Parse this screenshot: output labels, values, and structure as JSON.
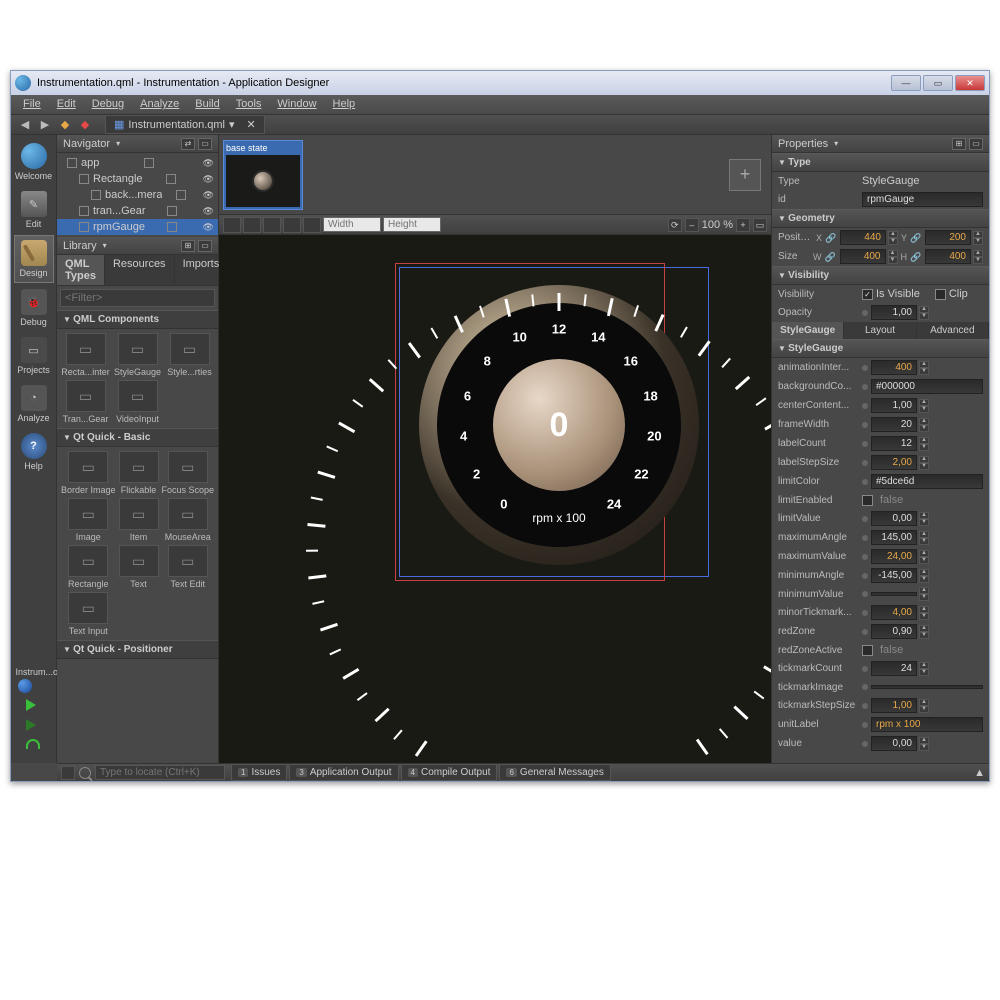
{
  "window": {
    "title": "Instrumentation.qml - Instrumentation - Application Designer"
  },
  "menu": [
    "File",
    "Edit",
    "Debug",
    "Analyze",
    "Build",
    "Tools",
    "Window",
    "Help"
  ],
  "open_tab": "Instrumentation.qml",
  "activity": [
    "Welcome",
    "Edit",
    "Design",
    "Debug",
    "Projects",
    "Analyze",
    "Help"
  ],
  "activity_project": "Instrum...on",
  "navigator": {
    "title": "Navigator",
    "items": [
      {
        "label": "app",
        "indent": 0,
        "sel": false,
        "eye": true
      },
      {
        "label": "Rectangle",
        "indent": 1,
        "sel": false,
        "eye": true
      },
      {
        "label": "back...mera",
        "indent": 2,
        "sel": false,
        "eye": true
      },
      {
        "label": "tran...Gear",
        "indent": 1,
        "sel": false,
        "eye": true
      },
      {
        "label": "rpmGauge",
        "indent": 1,
        "sel": true,
        "eye": true
      }
    ]
  },
  "library": {
    "title": "Library",
    "tabs": [
      "QML Types",
      "Resources",
      "Imports"
    ],
    "filter_placeholder": "<Filter>",
    "sections": [
      {
        "name": "QML Components",
        "items": [
          "Recta...inter",
          "StyleGauge",
          "Style...rties",
          "Tran...Gear",
          "VideoInput"
        ]
      },
      {
        "name": "Qt Quick - Basic",
        "items": [
          "Border Image",
          "Flickable",
          "Focus Scope",
          "Image",
          "Item",
          "MouseArea",
          "Rectangle",
          "Text",
          "Text Edit",
          "Text Input"
        ]
      },
      {
        "name": "Qt Quick - Positioner",
        "items": []
      }
    ]
  },
  "state": {
    "label": "base state",
    "add": "+"
  },
  "canvas": {
    "width_ph": "Width",
    "height_ph": "Height",
    "zoom": "100 %"
  },
  "gauge": {
    "value": "0",
    "unit": "rpm x 100",
    "numbers": [
      "0",
      "2",
      "4",
      "6",
      "8",
      "10",
      "12",
      "14",
      "16",
      "18",
      "20",
      "22",
      "24"
    ]
  },
  "properties": {
    "title": "Properties",
    "type_section": "Type",
    "type_label": "Type",
    "type_value": "StyleGauge",
    "id_label": "id",
    "id_value": "rpmGauge",
    "geometry_section": "Geometry",
    "position_label": "Position",
    "pos_x": "440",
    "pos_y": "200",
    "size_label": "Size",
    "size_w": "400",
    "size_h": "400",
    "visibility_section": "Visibility",
    "visibility_label": "Visibility",
    "is_visible": "Is Visible",
    "clip": "Clip",
    "opacity_label": "Opacity",
    "opacity": "1,00",
    "tabs": [
      "StyleGauge",
      "Layout",
      "Advanced"
    ],
    "sg_section": "StyleGauge",
    "rows": [
      {
        "l": "animationInter...",
        "v": "400",
        "num": true,
        "orange": true
      },
      {
        "l": "backgroundCo...",
        "v": "#000000",
        "num": false
      },
      {
        "l": "centerContent...",
        "v": "1,00",
        "num": true
      },
      {
        "l": "frameWidth",
        "v": "20",
        "num": true
      },
      {
        "l": "labelCount",
        "v": "12",
        "num": true
      },
      {
        "l": "labelStepSize",
        "v": "2,00",
        "num": true,
        "orange": true
      },
      {
        "l": "limitColor",
        "v": "#5dce6d",
        "num": false
      },
      {
        "l": "limitEnabled",
        "v": "false",
        "chk": true
      },
      {
        "l": "limitValue",
        "v": "0,00",
        "num": true
      },
      {
        "l": "maximumAngle",
        "v": "145,00",
        "num": true
      },
      {
        "l": "maximumValue",
        "v": "24,00",
        "num": true,
        "orange": true
      },
      {
        "l": "minimumAngle",
        "v": "-145,00",
        "num": true
      },
      {
        "l": "minimumValue",
        "v": "",
        "num": true
      },
      {
        "l": "minorTickmark...",
        "v": "4,00",
        "num": true,
        "orange": true
      },
      {
        "l": "redZone",
        "v": "0,90",
        "num": true
      },
      {
        "l": "redZoneActive",
        "v": "false",
        "chk": true
      },
      {
        "l": "tickmarkCount",
        "v": "24",
        "num": true
      },
      {
        "l": "tickmarkImage",
        "v": "",
        "num": false
      },
      {
        "l": "tickmarkStepSize",
        "v": "1,00",
        "num": true,
        "orange": true
      },
      {
        "l": "unitLabel",
        "v": "rpm x 100",
        "num": false,
        "orange": true
      },
      {
        "l": "value",
        "v": "0,00",
        "num": true
      }
    ]
  },
  "bottom": {
    "search_ph": "Type to locate (Ctrl+K)",
    "tabs": [
      {
        "n": "1",
        "l": "Issues"
      },
      {
        "n": "3",
        "l": "Application Output"
      },
      {
        "n": "4",
        "l": "Compile Output"
      },
      {
        "n": "6",
        "l": "General Messages"
      }
    ]
  }
}
